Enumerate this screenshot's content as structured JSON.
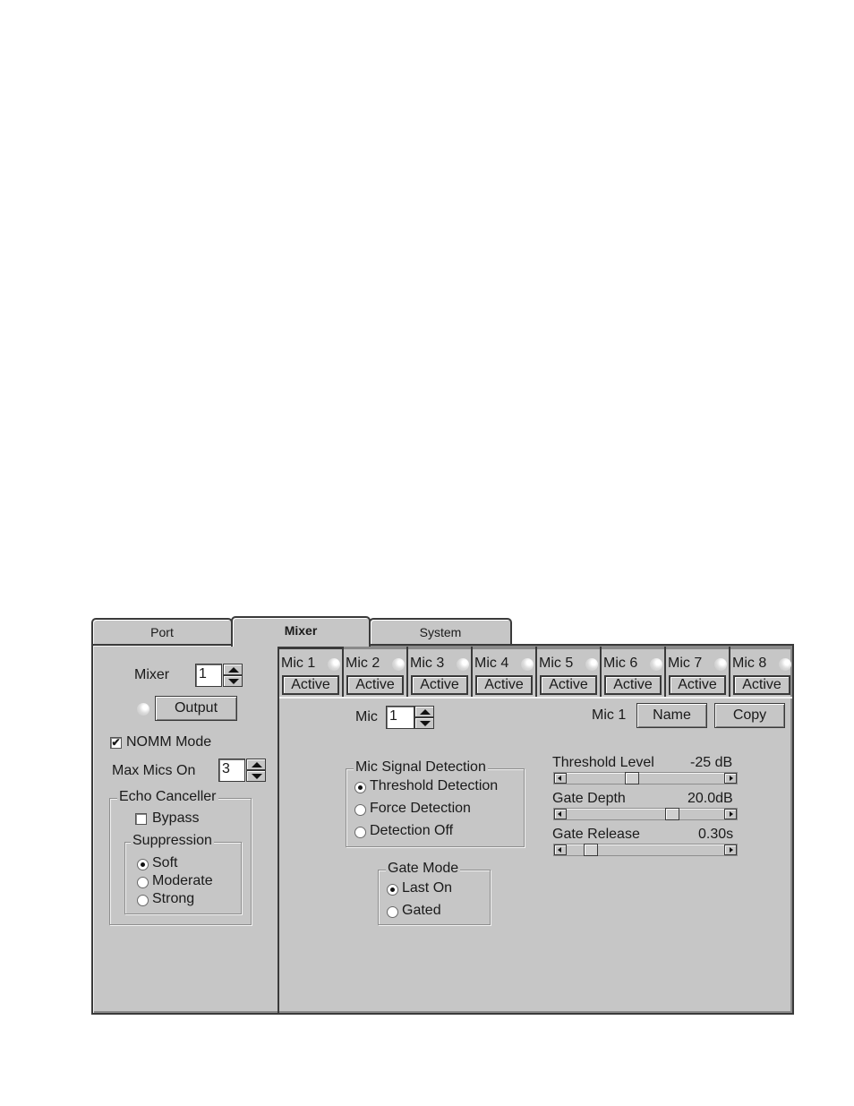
{
  "tabs": [
    {
      "label": "Port",
      "active": false
    },
    {
      "label": "Mixer",
      "active": true
    },
    {
      "label": "System",
      "active": false
    }
  ],
  "left": {
    "mixer_label": "Mixer",
    "mixer_value": "1",
    "output_label": "Output",
    "nomm_label": "NOMM Mode",
    "nomm_checked": true,
    "nomm_check_glyph": "✔",
    "max_mics_label": "Max Mics On",
    "max_mics_value": "3",
    "echo_group_title": "Echo Canceller",
    "bypass_label": "Bypass",
    "bypass_checked": false,
    "suppression_title": "Suppression",
    "suppression_options": [
      {
        "label": "Soft",
        "selected": true
      },
      {
        "label": "Moderate",
        "selected": false
      },
      {
        "label": "Strong",
        "selected": false
      }
    ]
  },
  "mic_tabs": [
    {
      "name": "Mic 1",
      "button": "Active",
      "selected": true
    },
    {
      "name": "Mic 2",
      "button": "Active",
      "selected": false
    },
    {
      "name": "Mic 3",
      "button": "Active",
      "selected": false
    },
    {
      "name": "Mic 4",
      "button": "Active",
      "selected": false
    },
    {
      "name": "Mic 5",
      "button": "Active",
      "selected": false
    },
    {
      "name": "Mic 6",
      "button": "Active",
      "selected": false
    },
    {
      "name": "Mic 7",
      "button": "Active",
      "selected": false
    },
    {
      "name": "Mic 8",
      "button": "Active",
      "selected": false
    }
  ],
  "mic_panel": {
    "mic_label": "Mic",
    "mic_value": "1",
    "mic_name": "Mic 1",
    "name_button": "Name",
    "copy_button": "Copy",
    "signal_detection_title": "Mic Signal Detection",
    "signal_detection_options": [
      {
        "label": "Threshold Detection",
        "selected": true
      },
      {
        "label": "Force Detection",
        "selected": false
      },
      {
        "label": "Detection Off",
        "selected": false
      }
    ],
    "gate_mode_title": "Gate Mode",
    "gate_mode_options": [
      {
        "label": "Last On",
        "selected": true
      },
      {
        "label": "Gated",
        "selected": false
      }
    ],
    "sliders": [
      {
        "label": "Threshold Level",
        "value": "-25 dB",
        "position_fraction": 0.4
      },
      {
        "label": "Gate Depth",
        "value": "20.0dB",
        "position_fraction": 0.68
      },
      {
        "label": "Gate Release",
        "value": "0.30s",
        "position_fraction": 0.12
      }
    ]
  }
}
